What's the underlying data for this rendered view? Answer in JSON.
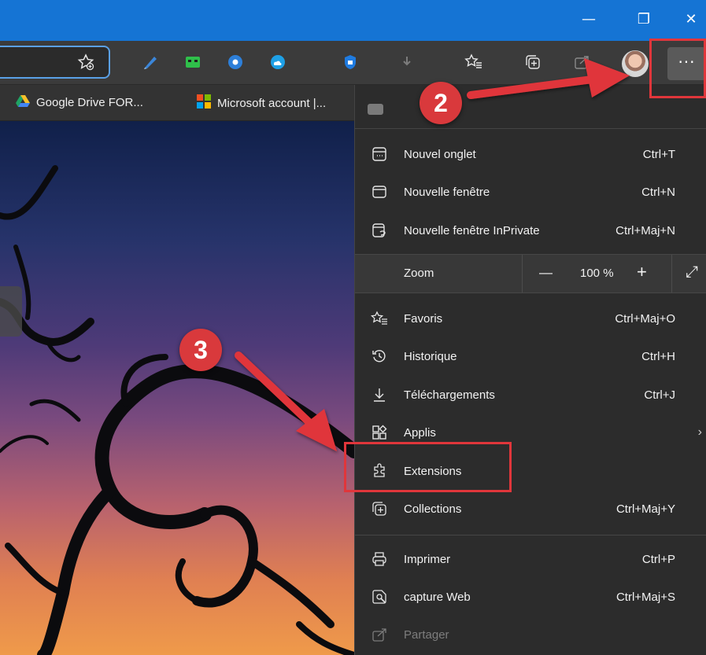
{
  "window": {
    "minimize_glyph": "—",
    "restore_glyph": "❐",
    "close_glyph": "✕"
  },
  "toolbar": {
    "icons": [
      "favorite-add-icon",
      "pen-extension-icon",
      "green-extension-icon",
      "blue-gear-extension-icon",
      "cloud-extension-icon",
      "shield-extension-icon",
      "download-icon",
      "favorites-icon",
      "collections-icon",
      "share-icon"
    ],
    "more_label": "···"
  },
  "favorites_bar": [
    {
      "label": "Google Drive FOR...",
      "icon": "google-drive-icon"
    },
    {
      "label": "Microsoft account |...",
      "icon": "microsoft-icon"
    }
  ],
  "menu": {
    "items_group1": [
      {
        "label": "Nouvel onglet",
        "shortcut": "Ctrl+T",
        "icon": "new-tab-icon"
      },
      {
        "label": "Nouvelle fenêtre",
        "shortcut": "Ctrl+N",
        "icon": "new-window-icon"
      },
      {
        "label": "Nouvelle fenêtre InPrivate",
        "shortcut": "Ctrl+Maj+N",
        "icon": "inprivate-icon"
      }
    ],
    "zoom": {
      "label": "Zoom",
      "minus": "—",
      "value": "100 %",
      "plus": "+",
      "fullscreen": "⤢"
    },
    "items_group2": [
      {
        "label": "Favoris",
        "shortcut": "Ctrl+Maj+O",
        "icon": "favorites-icon"
      },
      {
        "label": "Historique",
        "shortcut": "Ctrl+H",
        "icon": "history-icon"
      },
      {
        "label": "Téléchargements",
        "shortcut": "Ctrl+J",
        "icon": "download-icon"
      },
      {
        "label": "Applis",
        "shortcut": "",
        "icon": "apps-icon",
        "arrow": "›"
      },
      {
        "label": "Extensions",
        "shortcut": "",
        "icon": "extensions-icon"
      },
      {
        "label": "Collections",
        "shortcut": "Ctrl+Maj+Y",
        "icon": "collections-icon"
      }
    ],
    "items_group3": [
      {
        "label": "Imprimer",
        "shortcut": "Ctrl+P",
        "icon": "print-icon"
      },
      {
        "label": "capture Web",
        "shortcut": "Ctrl+Maj+S",
        "icon": "web-capture-icon"
      },
      {
        "label": "Partager",
        "shortcut": "",
        "icon": "share-icon",
        "disabled": true
      }
    ]
  },
  "annotations": {
    "step2": "2",
    "step3": "3",
    "color": "#e0363b"
  },
  "colors": {
    "titlebar": "#1574d4",
    "menu_bg": "#2c2c2c",
    "toolbar_bg": "#3b3b3b"
  }
}
